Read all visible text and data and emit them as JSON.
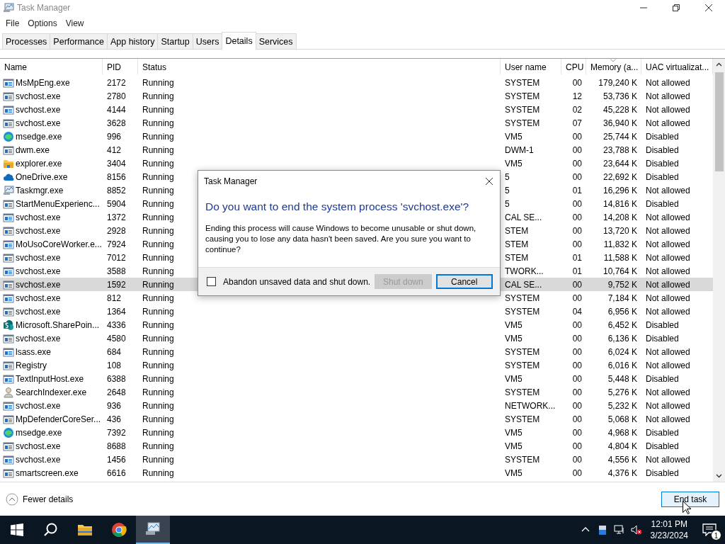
{
  "window": {
    "title": "Task Manager"
  },
  "menu": [
    "File",
    "Options",
    "View"
  ],
  "tabs": [
    {
      "label": "Processes",
      "selected": false
    },
    {
      "label": "Performance",
      "selected": false
    },
    {
      "label": "App history",
      "selected": false
    },
    {
      "label": "Startup",
      "selected": false
    },
    {
      "label": "Users",
      "selected": false
    },
    {
      "label": "Details",
      "selected": true
    },
    {
      "label": "Services",
      "selected": false
    }
  ],
  "table": {
    "columns": [
      {
        "label": "Name",
        "sorted": false
      },
      {
        "label": "PID",
        "sorted": false
      },
      {
        "label": "Status",
        "sorted": false
      },
      {
        "label": "User name",
        "sorted": false
      },
      {
        "label": "CPU",
        "sorted": false
      },
      {
        "label": "Memory (a...",
        "sorted": true
      },
      {
        "label": "UAC virtualizat...",
        "sorted": false
      }
    ],
    "rows": [
      {
        "kind": "app",
        "cells": [
          "MsMpEng.exe",
          "2172",
          "Running",
          "SYSTEM",
          "00",
          "179,240 K",
          "Not allowed"
        ],
        "selected": false
      },
      {
        "kind": "app",
        "cells": [
          "svchost.exe",
          "2780",
          "Running",
          "SYSTEM",
          "12",
          "53,736 K",
          "Not allowed"
        ],
        "selected": false
      },
      {
        "kind": "app",
        "cells": [
          "svchost.exe",
          "4144",
          "Running",
          "SYSTEM",
          "02",
          "45,228 K",
          "Not allowed"
        ],
        "selected": false
      },
      {
        "kind": "app",
        "cells": [
          "svchost.exe",
          "3628",
          "Running",
          "SYSTEM",
          "07",
          "36,940 K",
          "Not allowed"
        ],
        "selected": false
      },
      {
        "kind": "edge",
        "cells": [
          "msedge.exe",
          "996",
          "Running",
          "VM5",
          "00",
          "25,744 K",
          "Disabled"
        ],
        "selected": false
      },
      {
        "kind": "app",
        "cells": [
          "dwm.exe",
          "412",
          "Running",
          "DWM-1",
          "00",
          "23,788 K",
          "Disabled"
        ],
        "selected": false
      },
      {
        "kind": "folder",
        "cells": [
          "explorer.exe",
          "3404",
          "Running",
          "VM5",
          "00",
          "23,644 K",
          "Disabled"
        ],
        "selected": false
      },
      {
        "kind": "cloud",
        "cells": [
          "OneDrive.exe",
          "8156",
          "Running",
          "5",
          "00",
          "22,692 K",
          "Disabled"
        ],
        "selected": false
      },
      {
        "kind": "monitor",
        "cells": [
          "Taskmgr.exe",
          "8852",
          "Running",
          "5",
          "01",
          "16,296 K",
          "Not allowed"
        ],
        "selected": false
      },
      {
        "kind": "app",
        "cells": [
          "StartMenuExperienc...",
          "5904",
          "Running",
          "5",
          "00",
          "14,816 K",
          "Disabled"
        ],
        "selected": false
      },
      {
        "kind": "app",
        "cells": [
          "svchost.exe",
          "1372",
          "Running",
          "CAL SE...",
          "00",
          "14,208 K",
          "Not allowed"
        ],
        "selected": false
      },
      {
        "kind": "app",
        "cells": [
          "svchost.exe",
          "2928",
          "Running",
          "STEM",
          "00",
          "13,720 K",
          "Not allowed"
        ],
        "selected": false
      },
      {
        "kind": "app",
        "cells": [
          "MoUsoCoreWorker.e...",
          "7924",
          "Running",
          "STEM",
          "00",
          "11,832 K",
          "Not allowed"
        ],
        "selected": false
      },
      {
        "kind": "app",
        "cells": [
          "svchost.exe",
          "7012",
          "Running",
          "STEM",
          "01",
          "11,588 K",
          "Not allowed"
        ],
        "selected": false
      },
      {
        "kind": "app",
        "cells": [
          "svchost.exe",
          "3588",
          "Running",
          "TWORK...",
          "01",
          "10,764 K",
          "Not allowed"
        ],
        "selected": false
      },
      {
        "kind": "app",
        "cells": [
          "svchost.exe",
          "1592",
          "Running",
          "CAL SE...",
          "00",
          "9,752 K",
          "Not allowed"
        ],
        "selected": true
      },
      {
        "kind": "app",
        "cells": [
          "svchost.exe",
          "812",
          "Running",
          "SYSTEM",
          "00",
          "7,184 K",
          "Not allowed"
        ],
        "selected": false
      },
      {
        "kind": "app",
        "cells": [
          "svchost.exe",
          "1364",
          "Running",
          "SYSTEM",
          "04",
          "6,956 K",
          "Not allowed"
        ],
        "selected": false
      },
      {
        "kind": "sharepoint",
        "cells": [
          "Microsoft.SharePoin...",
          "4336",
          "Running",
          "VM5",
          "00",
          "6,452 K",
          "Disabled"
        ],
        "selected": false
      },
      {
        "kind": "app",
        "cells": [
          "svchost.exe",
          "4580",
          "Running",
          "VM5",
          "00",
          "6,136 K",
          "Disabled"
        ],
        "selected": false
      },
      {
        "kind": "app",
        "cells": [
          "lsass.exe",
          "684",
          "Running",
          "SYSTEM",
          "00",
          "6,024 K",
          "Not allowed"
        ],
        "selected": false
      },
      {
        "kind": "app",
        "cells": [
          "Registry",
          "108",
          "Running",
          "SYSTEM",
          "00",
          "6,016 K",
          "Not allowed"
        ],
        "selected": false
      },
      {
        "kind": "app",
        "cells": [
          "TextInputHost.exe",
          "6388",
          "Running",
          "VM5",
          "00",
          "5,448 K",
          "Disabled"
        ],
        "selected": false
      },
      {
        "kind": "person",
        "cells": [
          "SearchIndexer.exe",
          "2648",
          "Running",
          "SYSTEM",
          "00",
          "5,276 K",
          "Not allowed"
        ],
        "selected": false
      },
      {
        "kind": "app",
        "cells": [
          "svchost.exe",
          "936",
          "Running",
          "NETWORK...",
          "00",
          "5,232 K",
          "Not allowed"
        ],
        "selected": false
      },
      {
        "kind": "app",
        "cells": [
          "MpDefenderCoreSer...",
          "436",
          "Running",
          "SYSTEM",
          "00",
          "5,068 K",
          "Not allowed"
        ],
        "selected": false
      },
      {
        "kind": "edge",
        "cells": [
          "msedge.exe",
          "7392",
          "Running",
          "VM5",
          "00",
          "4,968 K",
          "Disabled"
        ],
        "selected": false
      },
      {
        "kind": "app",
        "cells": [
          "svchost.exe",
          "8688",
          "Running",
          "VM5",
          "00",
          "4,804 K",
          "Disabled"
        ],
        "selected": false
      },
      {
        "kind": "app",
        "cells": [
          "svchost.exe",
          "1456",
          "Running",
          "SYSTEM",
          "00",
          "4,556 K",
          "Not allowed"
        ],
        "selected": false
      },
      {
        "kind": "app",
        "cells": [
          "smartscreen.exe",
          "6616",
          "Running",
          "VM5",
          "00",
          "4,376 K",
          "Disabled"
        ],
        "selected": false
      }
    ]
  },
  "footer": {
    "fewer_details": "Fewer details",
    "end_task": {
      "label": "End task",
      "hovered": true
    }
  },
  "dialog": {
    "title": "Task Manager",
    "heading": "Do you want to end the system process 'svchost.exe'?",
    "message": "Ending this process will cause Windows to become unusable or shut down, causing you to lose any data hasn't been saved. Are you sure you want to continue?",
    "checkbox": {
      "label": "Abandon unsaved data and shut down.",
      "checked": false
    },
    "buttons": [
      {
        "label": "Shut down",
        "disabled": true,
        "focused": false
      },
      {
        "label": "Cancel",
        "disabled": false,
        "focused": true
      }
    ]
  },
  "taskbar": {
    "apps": [
      {
        "kind": "search"
      },
      {
        "kind": "folder"
      },
      {
        "kind": "chrome"
      },
      {
        "kind": "monitor",
        "active": true
      }
    ],
    "time": "12:01 PM",
    "date": "3/23/2024",
    "notifications": "1"
  }
}
